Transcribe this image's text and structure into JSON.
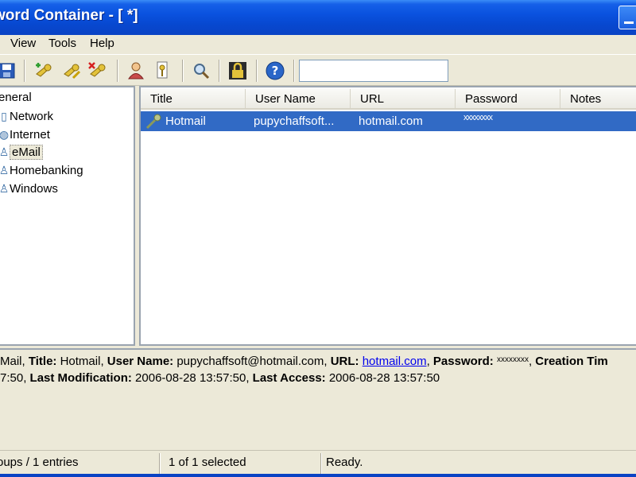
{
  "window": {
    "title": "word Container - [ *]"
  },
  "menu": [
    "View",
    "Tools",
    "Help"
  ],
  "toolbar": {
    "buttons": [
      "save-icon",
      "add-entry-icon",
      "edit-entry-icon",
      "delete-entry-icon",
      "user-icon",
      "key-icon",
      "find-icon",
      "lock-icon",
      "help-icon"
    ],
    "search": {
      "value": "",
      "placeholder": ""
    }
  },
  "tree": {
    "root": "eneral",
    "items": [
      {
        "label": "Network",
        "icon": "network-icon"
      },
      {
        "label": "Internet",
        "icon": "internet-icon"
      },
      {
        "label": "eMail",
        "icon": "email-icon",
        "selected": true
      },
      {
        "label": "Homebanking",
        "icon": "homebanking-icon"
      },
      {
        "label": "Windows",
        "icon": "windows-icon"
      }
    ]
  },
  "list": {
    "columns": [
      "Title",
      "User Name",
      "URL",
      "Password",
      "Notes"
    ],
    "rows": [
      {
        "title": "Hotmail",
        "user": "pupychaffsoft...",
        "url": "hotmail.com",
        "password": "xxxxxxxx",
        "notes": ""
      }
    ]
  },
  "details": {
    "prefix": "Mail, ",
    "title_label": "Title:",
    "title": "Hotmail",
    "user_label": "User Name:",
    "user": "pupychaffsoft@hotmail.com",
    "url_label": "URL:",
    "url": "hotmail.com",
    "pw_label": "Password:",
    "pw": "xxxxxxxx",
    "creation_label": "Creation Tim",
    "line2_prefix": "7:50,",
    "mod_label": "Last Modification:",
    "mod": "2006-08-28 13:57:50,",
    "access_label": "Last Access:",
    "access": "2006-08-28 13:57:50"
  },
  "status": {
    "groups": "oups / 1 entries",
    "selected": "1 of 1 selected",
    "state": "Ready."
  }
}
